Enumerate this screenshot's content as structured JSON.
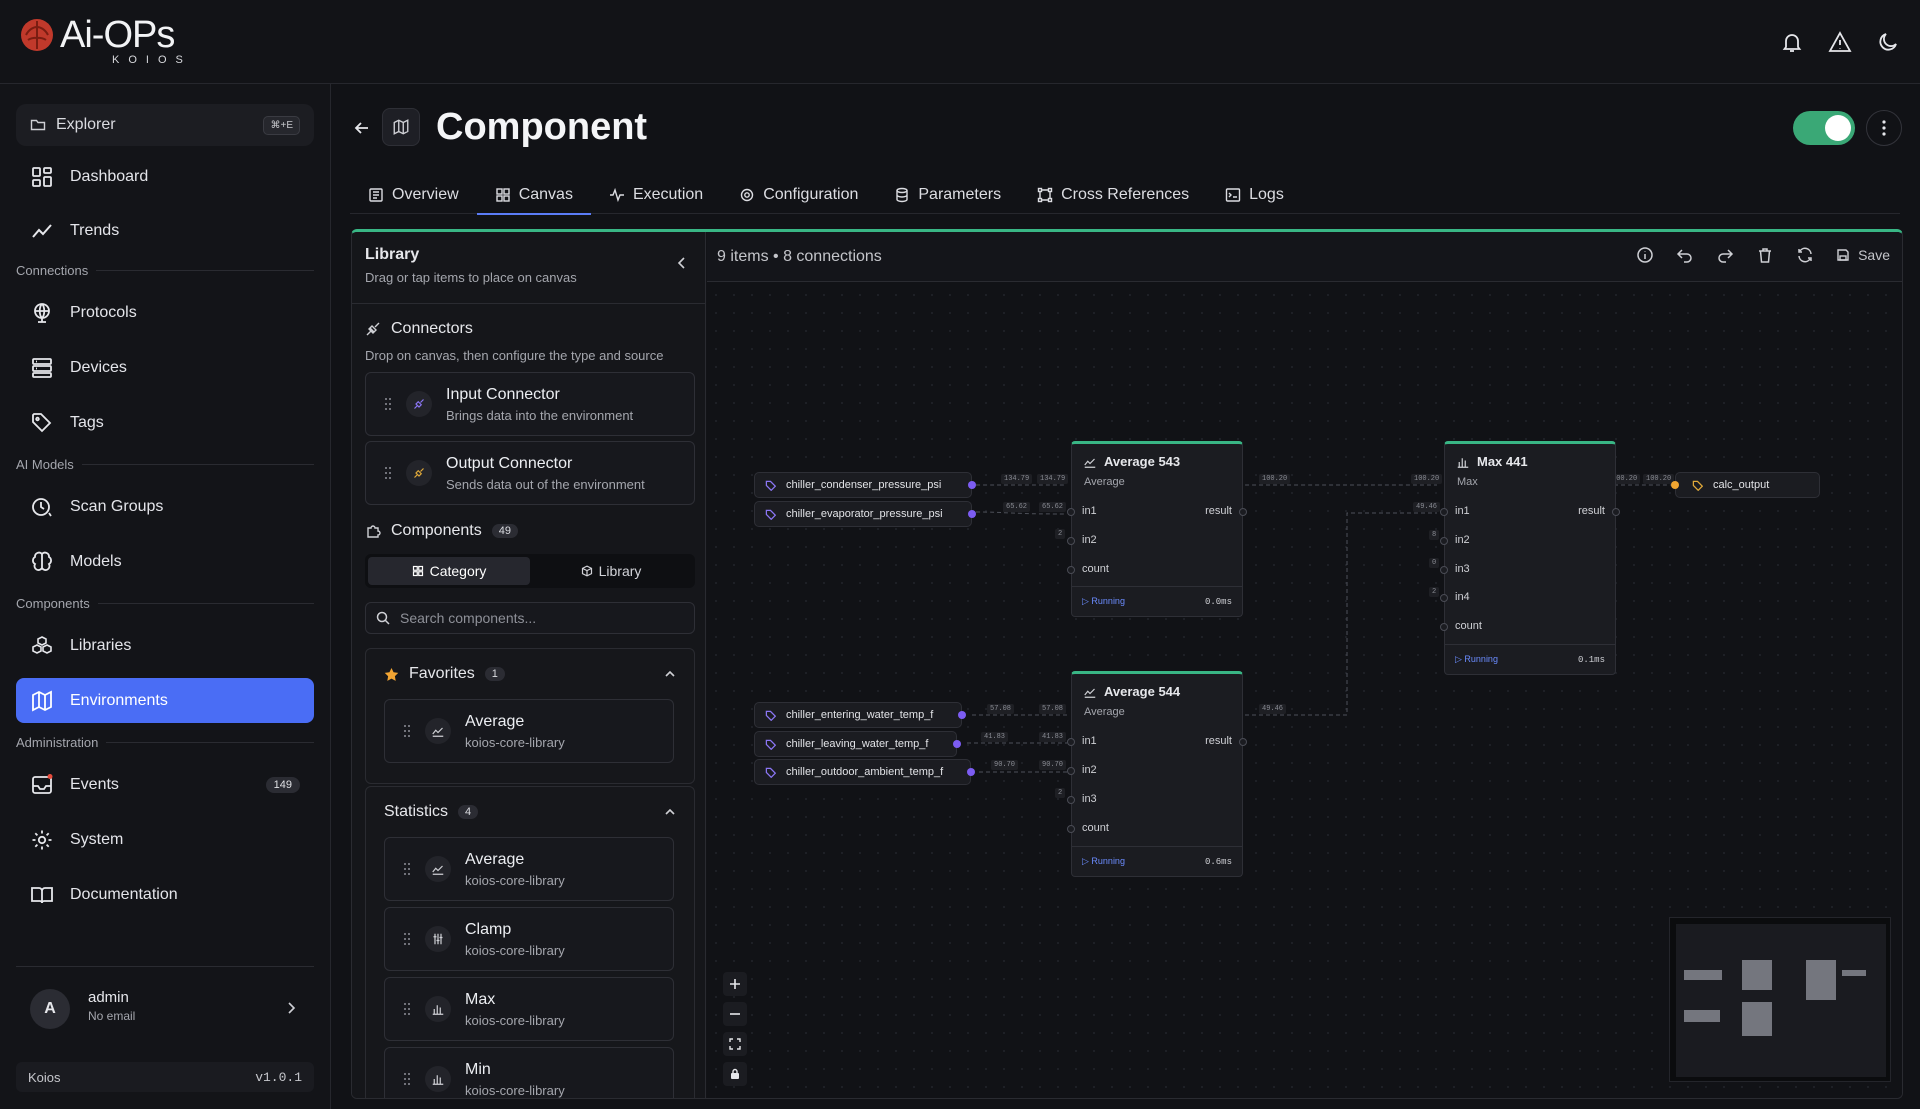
{
  "app": {
    "logo_word": "Ai-OPs",
    "logo_sub": "KOIOS"
  },
  "sidebar": {
    "explorer": {
      "label": "Explorer",
      "shortcut": "⌘+E"
    },
    "items": [
      {
        "label": "Dashboard",
        "icon": "dashboard-icon"
      },
      {
        "label": "Trends",
        "icon": "trend-icon"
      },
      {
        "label": "Protocols",
        "icon": "globe-icon"
      },
      {
        "label": "Devices",
        "icon": "server-icon"
      },
      {
        "label": "Tags",
        "icon": "tag-icon"
      },
      {
        "label": "Scan Groups",
        "icon": "clock-icon"
      },
      {
        "label": "Models",
        "icon": "brain-icon"
      },
      {
        "label": "Libraries",
        "icon": "boxes-icon"
      },
      {
        "label": "Environments",
        "icon": "map-icon"
      },
      {
        "label": "Events",
        "icon": "inbox-icon",
        "badge": "149"
      },
      {
        "label": "System",
        "icon": "gear-icon"
      },
      {
        "label": "Documentation",
        "icon": "book-icon"
      }
    ],
    "sections": [
      "Connections",
      "AI Models",
      "Components",
      "Administration"
    ],
    "user": {
      "initial": "A",
      "name": "admin",
      "email": "No email"
    },
    "version": {
      "name": "Koios",
      "value": "v1.0.1"
    }
  },
  "page": {
    "title": "Component"
  },
  "tabs": [
    "Overview",
    "Canvas",
    "Execution",
    "Configuration",
    "Parameters",
    "Cross References",
    "Logs"
  ],
  "library": {
    "title": "Library",
    "subtitle": "Drag or tap items to place on canvas",
    "connectors": {
      "title": "Connectors",
      "hint": "Drop on canvas, then configure the type and source",
      "items": [
        {
          "name": "Input Connector",
          "desc": "Brings data into the environment"
        },
        {
          "name": "Output Connector",
          "desc": "Sends data out of the environment"
        }
      ]
    },
    "components": {
      "title": "Components",
      "count": "49"
    },
    "segments": [
      "Category",
      "Library"
    ],
    "search_placeholder": "Search components...",
    "favorites": {
      "title": "Favorites",
      "count": "1",
      "items": [
        {
          "name": "Average",
          "desc": "koios-core-library"
        }
      ]
    },
    "statistics": {
      "title": "Statistics",
      "count": "4",
      "items": [
        {
          "name": "Average",
          "desc": "koios-core-library"
        },
        {
          "name": "Clamp",
          "desc": "koios-core-library"
        },
        {
          "name": "Max",
          "desc": "koios-core-library"
        },
        {
          "name": "Min",
          "desc": "koios-core-library"
        }
      ]
    }
  },
  "canvas": {
    "summary": "9 items • 8 connections",
    "save_label": "Save",
    "tags": [
      "chiller_condenser_pressure_psi",
      "chiller_evaporator_pressure_psi",
      "chiller_entering_water_temp_f",
      "chiller_leaving_water_temp_f",
      "chiller_outdoor_ambient_temp_f",
      "calc_output"
    ],
    "nodes": [
      {
        "title": "Average 543",
        "type": "Average",
        "inputs": [
          "in1",
          "in2",
          "count"
        ],
        "output": "result",
        "status": "Running",
        "time": "0.0ms"
      },
      {
        "title": "Max 441",
        "type": "Max",
        "inputs": [
          "in1",
          "in2",
          "in3",
          "in4",
          "count"
        ],
        "output": "result",
        "status": "Running",
        "time": "0.1ms"
      },
      {
        "title": "Average 544",
        "type": "Average",
        "inputs": [
          "in1",
          "in2",
          "in3",
          "count"
        ],
        "output": "result",
        "status": "Running",
        "time": "0.6ms"
      }
    ],
    "edge_labels": [
      "134.79",
      "134.79",
      "65.62",
      "65.62",
      "2",
      "100.20",
      "100.20",
      "49.46",
      "8",
      "0",
      "2",
      "100.20",
      "100.20",
      "57.08",
      "57.08",
      "41.83",
      "41.83",
      "90.70",
      "90.70",
      "2",
      "49.46"
    ]
  }
}
